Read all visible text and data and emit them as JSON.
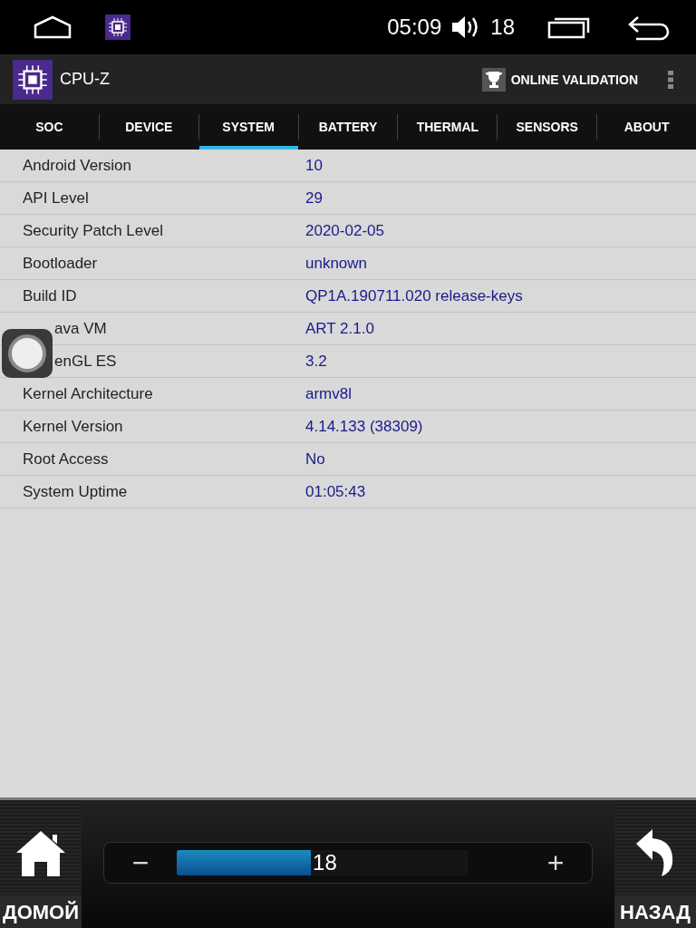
{
  "status_bar": {
    "time": "05:09",
    "volume": "18"
  },
  "app_bar": {
    "title": "CPU-Z",
    "action": "ONLINE VALIDATION"
  },
  "tabs": [
    {
      "label": "SOC",
      "selected": false
    },
    {
      "label": "DEVICE",
      "selected": false
    },
    {
      "label": "SYSTEM",
      "selected": true
    },
    {
      "label": "BATTERY",
      "selected": false
    },
    {
      "label": "THERMAL",
      "selected": false
    },
    {
      "label": "SENSORS",
      "selected": false
    },
    {
      "label": "ABOUT",
      "selected": false
    }
  ],
  "rows": [
    {
      "label": "Android Version",
      "value": "10",
      "covered": false
    },
    {
      "label": "API Level",
      "value": "29",
      "covered": false
    },
    {
      "label": "Security Patch Level",
      "value": "2020-02-05",
      "covered": false
    },
    {
      "label": "Bootloader",
      "value": "unknown",
      "covered": false
    },
    {
      "label": "Build ID",
      "value": "QP1A.190711.020 release-keys",
      "covered": false
    },
    {
      "label": "ava VM",
      "value": "ART 2.1.0",
      "covered": true
    },
    {
      "label": "enGL ES",
      "value": "3.2",
      "covered": true
    },
    {
      "label": "Kernel Architecture",
      "value": "armv8l",
      "covered": false
    },
    {
      "label": "Kernel Version",
      "value": "4.14.133 (38309)",
      "covered": false
    },
    {
      "label": "Root Access",
      "value": "No",
      "covered": false
    },
    {
      "label": "System Uptime",
      "value": "01:05:43",
      "covered": false
    }
  ],
  "bottom_bar": {
    "home_label": "ДОМОЙ",
    "back_label": "НАЗАД",
    "volume": {
      "minus": "−",
      "plus": "+",
      "reading": "18",
      "level": 0.46
    }
  }
}
